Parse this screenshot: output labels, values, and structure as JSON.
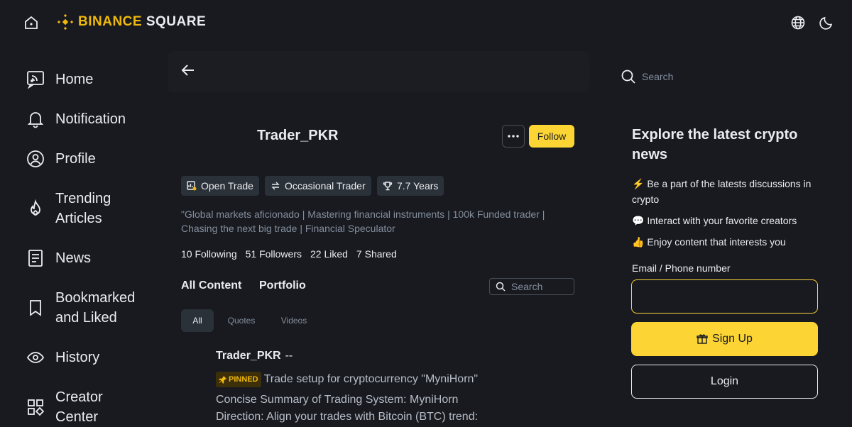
{
  "brand": {
    "name_part1": "BINANCE",
    "name_part2": "SQUARE"
  },
  "nav": [
    {
      "label": "Home",
      "icon": "home-feed-icon"
    },
    {
      "label": "Notification",
      "icon": "bell-icon"
    },
    {
      "label": "Profile",
      "icon": "user-icon"
    },
    {
      "label": "Trending Articles",
      "icon": "fire-icon"
    },
    {
      "label": "News",
      "icon": "news-icon"
    },
    {
      "label": "Bookmarked and Liked",
      "icon": "bookmark-icon"
    },
    {
      "label": "History",
      "icon": "eye-icon"
    },
    {
      "label": "Creator Center",
      "icon": "grid-icon"
    }
  ],
  "top_search": {
    "placeholder": "Search"
  },
  "profile": {
    "username": "Trader_PKR",
    "follow_label": "Follow",
    "badges": [
      {
        "label": "Open Trade",
        "icon": "trade-icon"
      },
      {
        "label": "Occasional Trader",
        "icon": "swap-icon"
      },
      {
        "label": "7.7 Years",
        "icon": "trophy-icon"
      }
    ],
    "bio": "\"Global markets aficionado | Mastering financial instruments | 100k Funded trader | Chasing the next big trade | Financial Speculator",
    "stats": [
      {
        "value": "10",
        "label": "Following"
      },
      {
        "value": "51",
        "label": "Followers"
      },
      {
        "value": "22",
        "label": "Liked"
      },
      {
        "value": "7",
        "label": "Shared"
      }
    ]
  },
  "content_tabs": {
    "all_content": "All Content",
    "portfolio": "Portfolio",
    "search_placeholder": "Search"
  },
  "filter_pills": [
    "All",
    "Quotes",
    "Videos"
  ],
  "post": {
    "author": "Trader_PKR",
    "separator": "--",
    "pinned_label": "PINNED",
    "title": "Trade setup for cryptocurrency \"MyniHorn\"",
    "line1": "Concise Summary of Trading System: MyniHorn",
    "line2": "Direction: Align your trades with Bitcoin (BTC) trend:"
  },
  "sidebar": {
    "heading": "Explore the latest crypto news",
    "items": [
      {
        "emoji": "⚡",
        "text": "Be a part of the latests discussions in crypto"
      },
      {
        "emoji": "💬",
        "text": "Interact with your favorite creators"
      },
      {
        "emoji": "👍",
        "text": "Enjoy content that interests you"
      }
    ],
    "email_label": "Email / Phone number",
    "email_value": "",
    "signup_label": "Sign Up",
    "login_label": "Login"
  },
  "colors": {
    "accent": "#fcd535",
    "brand": "#f0b90b",
    "bg": "#181a20",
    "chip": "#2b3139"
  }
}
